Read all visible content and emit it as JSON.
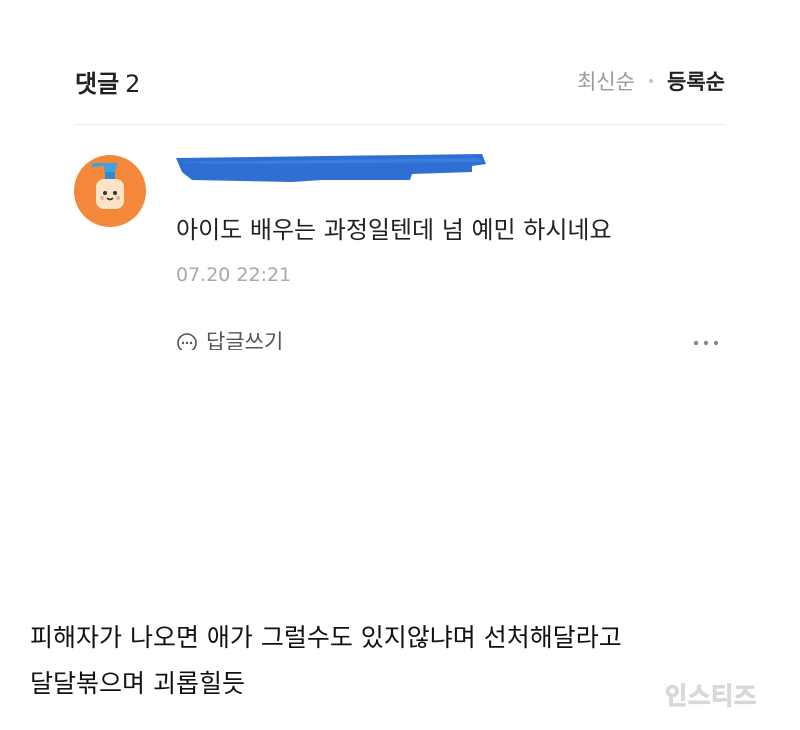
{
  "comments_header": {
    "title": "댓글",
    "count": "2",
    "sort_newest": "최신순",
    "sort_registered": "등록순"
  },
  "comment": {
    "avatar_icon": "spray-bottle-character-icon",
    "author_name_redacted": true,
    "text": "아이도 배우는 과정일텐데 넘 예민 하시네요",
    "timestamp": "07.20 22:21",
    "reply_label": "답글쓰기",
    "more_icon": "more-dots-icon"
  },
  "caption": {
    "line1": "피해자가 나오면 애가 그럴수도 있지않냐며 선처해달라고",
    "line2": "달달볶으며 괴롭힐듯"
  },
  "watermark": "인스티즈",
  "colors": {
    "avatar_bg": "#f3883a",
    "redaction_blue": "#2f6fd3",
    "muted_text": "#9a9a9a",
    "divider": "#ececec"
  }
}
